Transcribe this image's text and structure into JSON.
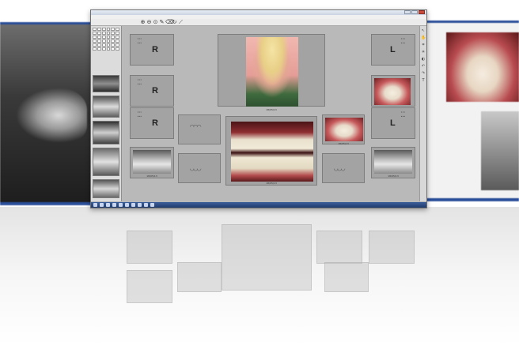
{
  "window": {
    "title": "",
    "menu": [
      "",
      "",
      "",
      "",
      "",
      "",
      ""
    ],
    "date_captions": [
      "18/05/13",
      "18/05/13",
      "18/05/13",
      "18/05/13",
      "18/05/13"
    ]
  },
  "slots": {
    "r_top": "R",
    "r_mid": "R",
    "r_bot": "R",
    "l_top": "L",
    "l_bot": "L"
  },
  "toolbar_icons": [
    "zoom-in-icon",
    "zoom-out-icon",
    "zoom-fit-icon",
    "pen-icon",
    "eraser-icon",
    "rotate-icon",
    "measure-icon"
  ],
  "colors": {
    "window_bg": "#b9b9b9",
    "slot_bg": "#a3a3a3",
    "taskbar": "#2b4f9a"
  }
}
